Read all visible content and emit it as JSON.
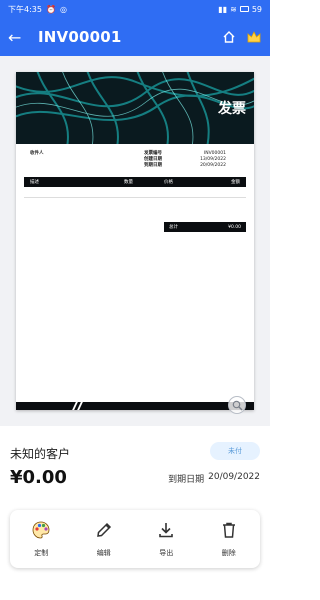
{
  "status_bar": {
    "time": "下午4:35",
    "battery": "59"
  },
  "app_bar": {
    "title": "INV00001"
  },
  "invoice": {
    "doc_title": "发票",
    "recipient_label": "收件人",
    "fields": [
      {
        "label": "发票编号",
        "value": "INV00001"
      },
      {
        "label": "创建日期",
        "value": "13/09/2022"
      },
      {
        "label": "到期日期",
        "value": "20/09/2022"
      }
    ],
    "table_headers": [
      "描述",
      "数量",
      "价格",
      "金额"
    ],
    "total_label": "总计",
    "total_value": "¥0.00"
  },
  "summary": {
    "client_name": "未知的客户",
    "status": "未付",
    "amount": "¥0.00",
    "due_label": "到期日期",
    "due_date": "20/09/2022"
  },
  "actions": [
    {
      "label": "定制",
      "icon": "palette-icon"
    },
    {
      "label": "编辑",
      "icon": "pencil-icon"
    },
    {
      "label": "导出",
      "icon": "download-icon"
    },
    {
      "label": "删除",
      "icon": "trash-icon"
    }
  ],
  "colors": {
    "primary": "#2f6df3",
    "accent": "#1fd1d1",
    "badge_bg": "#e6f2ff",
    "badge_text": "#5a9bd8"
  }
}
